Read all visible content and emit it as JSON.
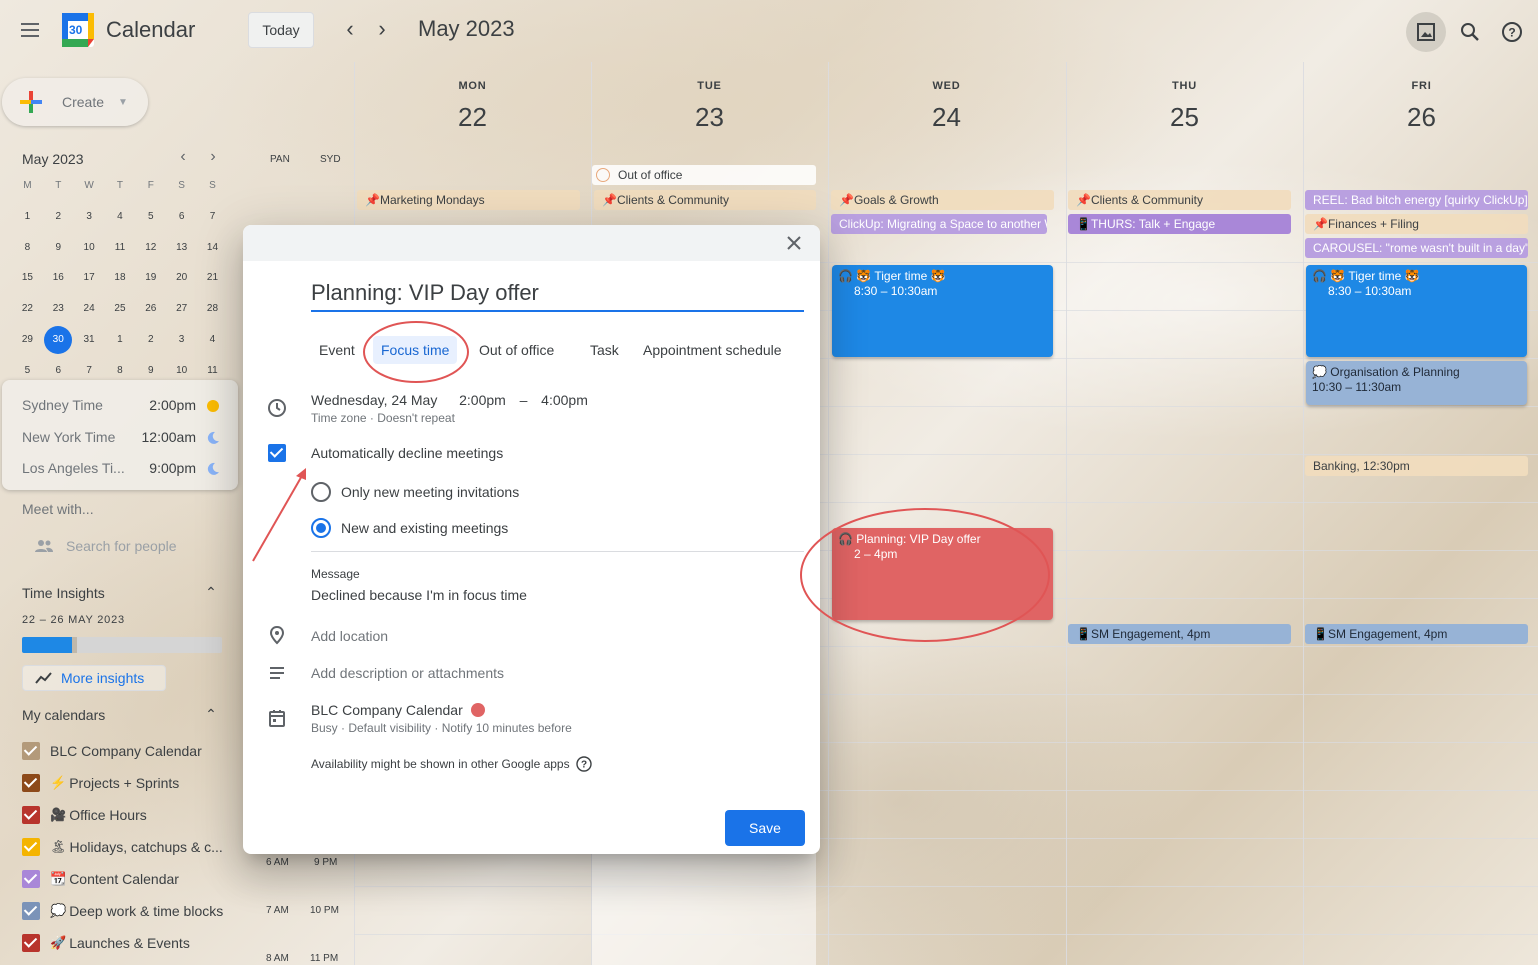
{
  "header": {
    "app_title": "Calendar",
    "today_label": "Today",
    "month_title": "May 2023",
    "logo_day": "30"
  },
  "sidebar": {
    "create_label": "Create",
    "mini_calendar": {
      "title": "May 2023",
      "weekday_headers": [
        "M",
        "T",
        "W",
        "T",
        "F",
        "S",
        "S"
      ],
      "weeks": [
        [
          "1",
          "2",
          "3",
          "4",
          "5",
          "6",
          "7"
        ],
        [
          "8",
          "9",
          "10",
          "11",
          "12",
          "13",
          "14"
        ],
        [
          "15",
          "16",
          "17",
          "18",
          "19",
          "20",
          "21"
        ],
        [
          "22",
          "23",
          "24",
          "25",
          "26",
          "27",
          "28"
        ],
        [
          "29",
          "30",
          "31",
          "1",
          "2",
          "3",
          "4"
        ],
        [
          "5",
          "6",
          "7",
          "8",
          "9",
          "10",
          "11"
        ]
      ],
      "today": "30"
    },
    "timezones": [
      {
        "name": "Sydney Time",
        "time": "2:00pm",
        "icon": "sun-icon"
      },
      {
        "name": "New York Time",
        "time": "12:00am",
        "icon": "moon-icon"
      },
      {
        "name": "Los Angeles Ti...",
        "time": "9:00pm",
        "icon": "moon-icon"
      }
    ],
    "meet_title": "Meet with...",
    "search_people_placeholder": "Search for people",
    "time_insights": {
      "title": "Time Insights",
      "range": "22 – 26 MAY 2023",
      "bar_fill_fraction": 0.25,
      "more_label": "More insights"
    },
    "my_calendars": {
      "title": "My calendars",
      "items": [
        {
          "label": "BLC Company Calendar",
          "color": "#b39a7a",
          "emoji": ""
        },
        {
          "label": "Projects + Sprints",
          "color": "#8d4a1a",
          "emoji": "⚡"
        },
        {
          "label": "Office Hours",
          "color": "#b8342c",
          "emoji": "🎥"
        },
        {
          "label": "Holidays, catchups & c...",
          "color": "#f4b400",
          "emoji": "🏝"
        },
        {
          "label": "Content Calendar",
          "color": "#a987d8",
          "emoji": "📆"
        },
        {
          "label": "Deep work & time blocks",
          "color": "#7b93b8",
          "emoji": "💭"
        },
        {
          "label": "Launches & Events",
          "color": "#b8342c",
          "emoji": "🚀"
        }
      ]
    }
  },
  "calendar": {
    "tz_labels": [
      "PAN",
      "SYD"
    ],
    "days": [
      {
        "name": "MON",
        "num": "22"
      },
      {
        "name": "TUE",
        "num": "23"
      },
      {
        "name": "WED",
        "num": "24"
      },
      {
        "name": "THU",
        "num": "25"
      },
      {
        "name": "FRI",
        "num": "26"
      }
    ],
    "hour_labels": [
      {
        "left": "6 AM",
        "right": "9 PM"
      },
      {
        "left": "7 AM",
        "right": "10 PM"
      },
      {
        "left": "8 AM",
        "right": "11 PM"
      }
    ],
    "allday": {
      "mon": "📌Marketing Mondays",
      "tue_ooo": "Out of office",
      "tue": "📌Clients & Community",
      "wed_1": "📌Goals & Growth",
      "wed_2": "ClickUp: Migrating a Space to another W",
      "thu_1": "📌Clients & Community",
      "thu_2": "📱THURS: Talk + Engage",
      "fri_1": "REEL: Bad bitch energy [quirky ClickUp]",
      "fri_2": "📌Finances + Filing",
      "fri_3": "CAROUSEL: \"rome wasn't built in a day\""
    },
    "events": {
      "wed_tiger_title": "🐯 Tiger time 🐯",
      "wed_tiger_time": "8:30 – 10:30am",
      "fri_tiger_title": "🐯 Tiger time 🐯",
      "fri_tiger_time": "8:30 – 10:30am",
      "fri_org_title": "💭 Organisation & Planning",
      "fri_org_time": "10:30 – 11:30am",
      "fri_banking_title": "Banking",
      "fri_banking_time": ", 12:30pm",
      "wed_planning_title": "Planning: VIP Day offer",
      "wed_planning_time": "2 – 4pm",
      "thu_sm_title": "📱SM Engagement",
      "thu_sm_time": ", 4pm",
      "fri_sm_title": "📱SM Engagement",
      "fri_sm_time": ", 4pm"
    },
    "colors": {
      "focus_blue": "#1e88e5",
      "focus_red": "#e06464",
      "deep_work": "#97b3d6",
      "content_purple": "#a987d8"
    }
  },
  "dialog": {
    "title_value": "Planning: VIP Day offer",
    "tabs": [
      "Event",
      "Focus time",
      "Out of office",
      "Task",
      "Appointment schedule"
    ],
    "active_tab": "Focus time",
    "date": "Wednesday, 24 May",
    "start_time": "2:00pm",
    "dash": "–",
    "end_time": "4:00pm",
    "date_sub": "Time zone · Doesn't repeat",
    "auto_decline_label": "Automatically decline meetings",
    "auto_decline_checked": true,
    "radio_options": [
      "Only new meeting invitations",
      "New and existing meetings"
    ],
    "radio_selected": "New and existing meetings",
    "message_label": "Message",
    "message_text": "Declined because I'm in focus time",
    "location_placeholder": "Add location",
    "description_placeholder": "Add description or attachments",
    "calendar_name": "BLC Company Calendar",
    "calendar_color": "#e06464",
    "calendar_sub": "Busy · Default visibility · Notify 10 minutes before",
    "availability_note": "Availability might be shown in other Google apps",
    "save_label": "Save"
  }
}
